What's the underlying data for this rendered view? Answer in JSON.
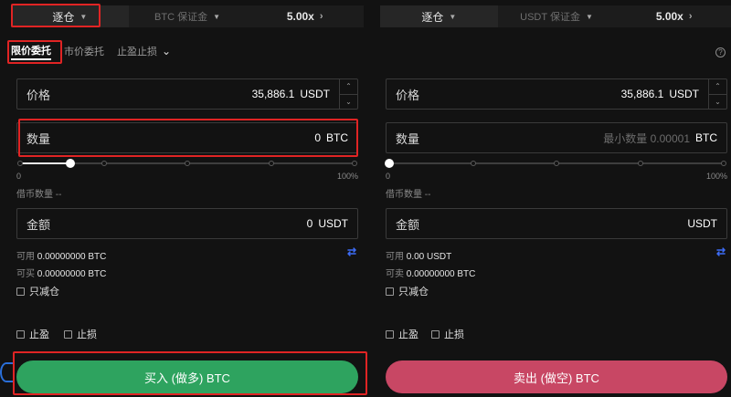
{
  "left": {
    "top": {
      "margin_mode": "逐仓",
      "margin_type": "BTC 保证金",
      "leverage": "5.00x"
    },
    "tabs": [
      "限价委托",
      "市价委托",
      "止盈止损"
    ],
    "price": {
      "label": "价格",
      "value": "35,886.1",
      "unit": "USDT"
    },
    "amount": {
      "label": "数量",
      "value": "0",
      "unit": "BTC"
    },
    "slider": {
      "min_label": "0",
      "max_label": "100%",
      "value_percent": 15
    },
    "borrow": "借币数量 --",
    "total": {
      "label": "金额",
      "value": "0",
      "unit": "USDT"
    },
    "available_label": "可用",
    "available_value": "0.00000000 BTC",
    "buyable_label": "可买",
    "buyable_value": "0.00000000 BTC",
    "reduce_only": "只减仓",
    "take_profit": "止盈",
    "stop_loss": "止损",
    "action": "买入 (做多) BTC"
  },
  "right": {
    "top": {
      "margin_mode": "逐仓",
      "margin_type": "USDT 保证金",
      "leverage": "5.00x"
    },
    "price": {
      "label": "价格",
      "value": "35,886.1",
      "unit": "USDT"
    },
    "amount": {
      "label": "数量",
      "placeholder": "最小数量 0.00001",
      "unit": "BTC"
    },
    "slider": {
      "min_label": "0",
      "max_label": "100%",
      "value_percent": 0
    },
    "borrow": "借币数量 --",
    "total": {
      "label": "金额",
      "unit": "USDT"
    },
    "available_label": "可用",
    "available_value": "0.00 USDT",
    "sellable_label": "可卖",
    "sellable_value": "0.00000000 BTC",
    "reduce_only": "只减仓",
    "take_profit": "止盈",
    "stop_loss": "止损",
    "action": "卖出 (做空) BTC"
  },
  "icons": {
    "caret": "▼",
    "chevron_right": "›",
    "chevron_down": "⌄",
    "swap": "⇄",
    "help": "?",
    "step_up": "⌃",
    "step_down": "⌄"
  },
  "colors": {
    "buy": "#2ea35f",
    "sell": "#c84764",
    "highlight": "#e02424",
    "link": "#3d6cf5"
  }
}
